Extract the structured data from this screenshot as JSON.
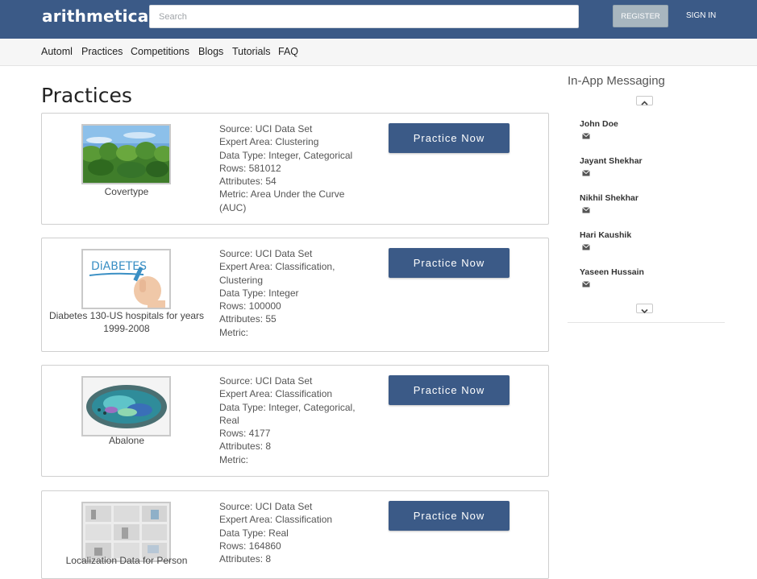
{
  "header": {
    "logo": "arithmetica",
    "search_placeholder": "Search",
    "register_label": "REGISTER",
    "signin_label": "SIGN IN"
  },
  "nav": [
    "Automl",
    "Practices",
    "Competitions",
    "Blogs",
    "Tutorials",
    "FAQ"
  ],
  "page_title": "Practices",
  "button_label": "Practice Now",
  "cards": [
    {
      "caption": "Covertype",
      "lines": [
        "Source: UCI Data Set",
        "Expert Area: Clustering",
        "Data Type: Integer, Categorical",
        "Rows: 581012",
        "Attributes: 54",
        "Metric: Area Under the Curve (AUC)"
      ]
    },
    {
      "caption": "Diabetes 130-US hospitals for years 1999-2008",
      "thumb_text": "DiABETES",
      "lines": [
        "Source: UCI Data Set",
        "Expert Area: Classification, Clustering",
        "Data Type: Integer",
        "Rows: 100000",
        "Attributes: 55",
        "Metric:"
      ]
    },
    {
      "caption": "Abalone",
      "lines": [
        "Source: UCI Data Set",
        "Expert Area: Classification",
        "Data Type: Integer, Categorical, Real",
        "Rows: 4177",
        "Attributes: 8",
        "Metric:"
      ]
    },
    {
      "caption": "Localization Data for Person",
      "lines": [
        "Source: UCI Data Set",
        "Expert Area: Classification",
        "Data Type: Real",
        "Rows: 164860",
        "Attributes: 8"
      ]
    }
  ],
  "sidebar": {
    "title": "In-App Messaging",
    "contacts": [
      "John Doe",
      "Jayant Shekhar",
      "Nikhil Shekhar",
      "Hari Kaushik",
      "Yaseen Hussain"
    ],
    "icons": {
      "contact": "mail-icon",
      "up": "chevron-up-icon",
      "down": "chevron-down-icon"
    }
  },
  "colors": {
    "brand": "#3b5a87",
    "register": "#a8b6bf",
    "nav_bg": "#f6f6f6"
  }
}
